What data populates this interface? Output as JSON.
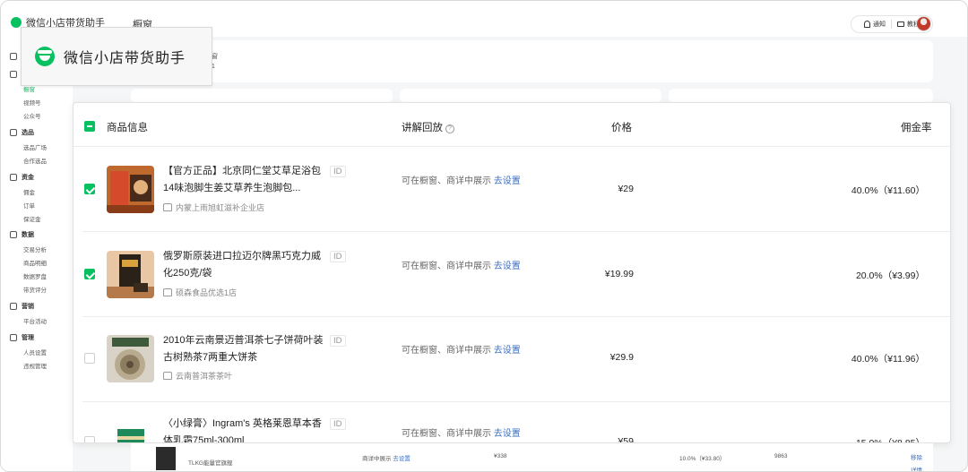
{
  "app": {
    "brand_small": "微信小店带货助手",
    "page_title": "橱窗",
    "brand_card_title": "微信小店带货助手",
    "notify_label": "通知",
    "tutorial_label": "教程"
  },
  "sidebar": {
    "groups": [
      {
        "label": "",
        "icon": "home-icon"
      },
      {
        "label": "",
        "icon": "window-icon",
        "items": [
          "橱窗",
          "视频号",
          "公众号"
        ]
      },
      {
        "label": "选品",
        "icon": "bag-icon",
        "items": [
          "选品广场",
          "合作选品"
        ]
      },
      {
        "label": "资金",
        "icon": "money-icon",
        "items": [
          "佣金",
          "订单",
          "保证金"
        ]
      },
      {
        "label": "数据",
        "icon": "data-icon",
        "items": [
          "交易分析",
          "商品明细",
          "数据罗盘",
          "带货评分"
        ]
      },
      {
        "label": "营销",
        "icon": "marketing-icon",
        "items": [
          "平台活动"
        ]
      },
      {
        "label": "管理",
        "icon": "manage-icon",
        "items": [
          "人员设置",
          "违规管理"
        ]
      }
    ]
  },
  "background": {
    "partial_texts": [
      "窗",
      "1"
    ]
  },
  "table": {
    "headers": {
      "product": "商品信息",
      "explain": "讲解回放",
      "price": "价格",
      "commission": "佣金率"
    },
    "rows": [
      {
        "checked": true,
        "name": "【官方正品】北京同仁堂艾草足浴包14味泡脚生姜艾草养生泡脚包...",
        "id": "ID",
        "shop": "内蒙上雨旭虹滋补企业店",
        "show": "可在橱窗、商详中展示",
        "show_link": "去设置",
        "price": "¥29",
        "commission": "40.0%（¥11.60）"
      },
      {
        "checked": true,
        "name": "俄罗斯原装进口拉迈尔牌黑巧克力威化250克/袋",
        "id": "ID",
        "shop": "硕森食品优选1店",
        "show": "可在橱窗、商详中展示",
        "show_link": "去设置",
        "price": "¥19.99",
        "commission": "20.0%（¥3.99）"
      },
      {
        "checked": false,
        "name": "2010年云南景迈普洱茶七子饼荷叶装古树熟茶7两重大饼茶",
        "id": "ID",
        "shop": "云南普洱茶茶叶",
        "show": "可在橱窗、商详中展示",
        "show_link": "去设置",
        "price": "¥29.9",
        "commission": "40.0%（¥11.96）"
      },
      {
        "checked": false,
        "name": "〈小绿膏〉Ingram's 英格莱恩草本香体乳霜75ml-300ml",
        "id": "ID",
        "shop": "",
        "show": "可在橱窗、商详中展示",
        "show_link": "去设置",
        "price": "¥59",
        "commission": "15.0%（¥8.85）"
      }
    ]
  },
  "bottom_strip": {
    "show": "商详中展示",
    "link": "去设置",
    "price": "¥338",
    "commission": "10.0%（¥33.80）",
    "count": "9863",
    "action1": "移除",
    "action2": "详情",
    "shop": "TLKG能量官旗舰"
  },
  "colors": {
    "accent": "#07c160",
    "link": "#3b6fc4"
  }
}
